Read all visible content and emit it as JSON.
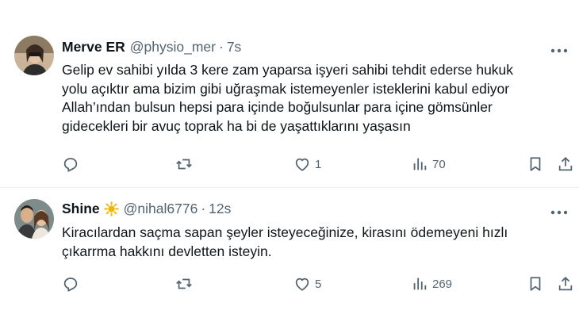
{
  "colors": {
    "text": "#0f1419",
    "secondary": "#536471",
    "divider": "#eff3f4",
    "icon": "#536471",
    "verified_sun": "#f4b400"
  },
  "tweets": [
    {
      "name": "Merve ER",
      "handle": "@physio_mer",
      "separator": "·",
      "time": "7s",
      "lines": [
        "Gelip ev sahibi yılda 3 kere zam yaparsa işyeri sahibi  tehdit ederse hukuk",
        "yolu açıktır ama bizim gibi uğraşmak istemeyenler isteklerini kabul ediyor",
        "Allah’ından bulsun hepsi para içinde boğulsunlar para içine gömsünler",
        "gidecekleri bir avuç toprak ha bi de yaşattıklarını yaşasın"
      ],
      "likes": "1",
      "views": "70",
      "icons": [
        "reply-icon",
        "retweet-icon",
        "heart-icon",
        "views-icon",
        "bookmark-icon",
        "share-icon",
        "more-icon"
      ]
    },
    {
      "name": "Shine",
      "handle": "@nihal6776",
      "separator": "·",
      "time": "12s",
      "lines": [
        "Kiracılardan saçma sapan şeyler isteyeceğinize, kirasını ödemeyeni hızlı",
        "çıkarrma hakkını devletten isteyin."
      ],
      "likes": "5",
      "views": "269",
      "icons": [
        "sun-emoji-icon",
        "reply-icon",
        "retweet-icon",
        "heart-icon",
        "views-icon",
        "bookmark-icon",
        "share-icon",
        "more-icon"
      ]
    }
  ]
}
